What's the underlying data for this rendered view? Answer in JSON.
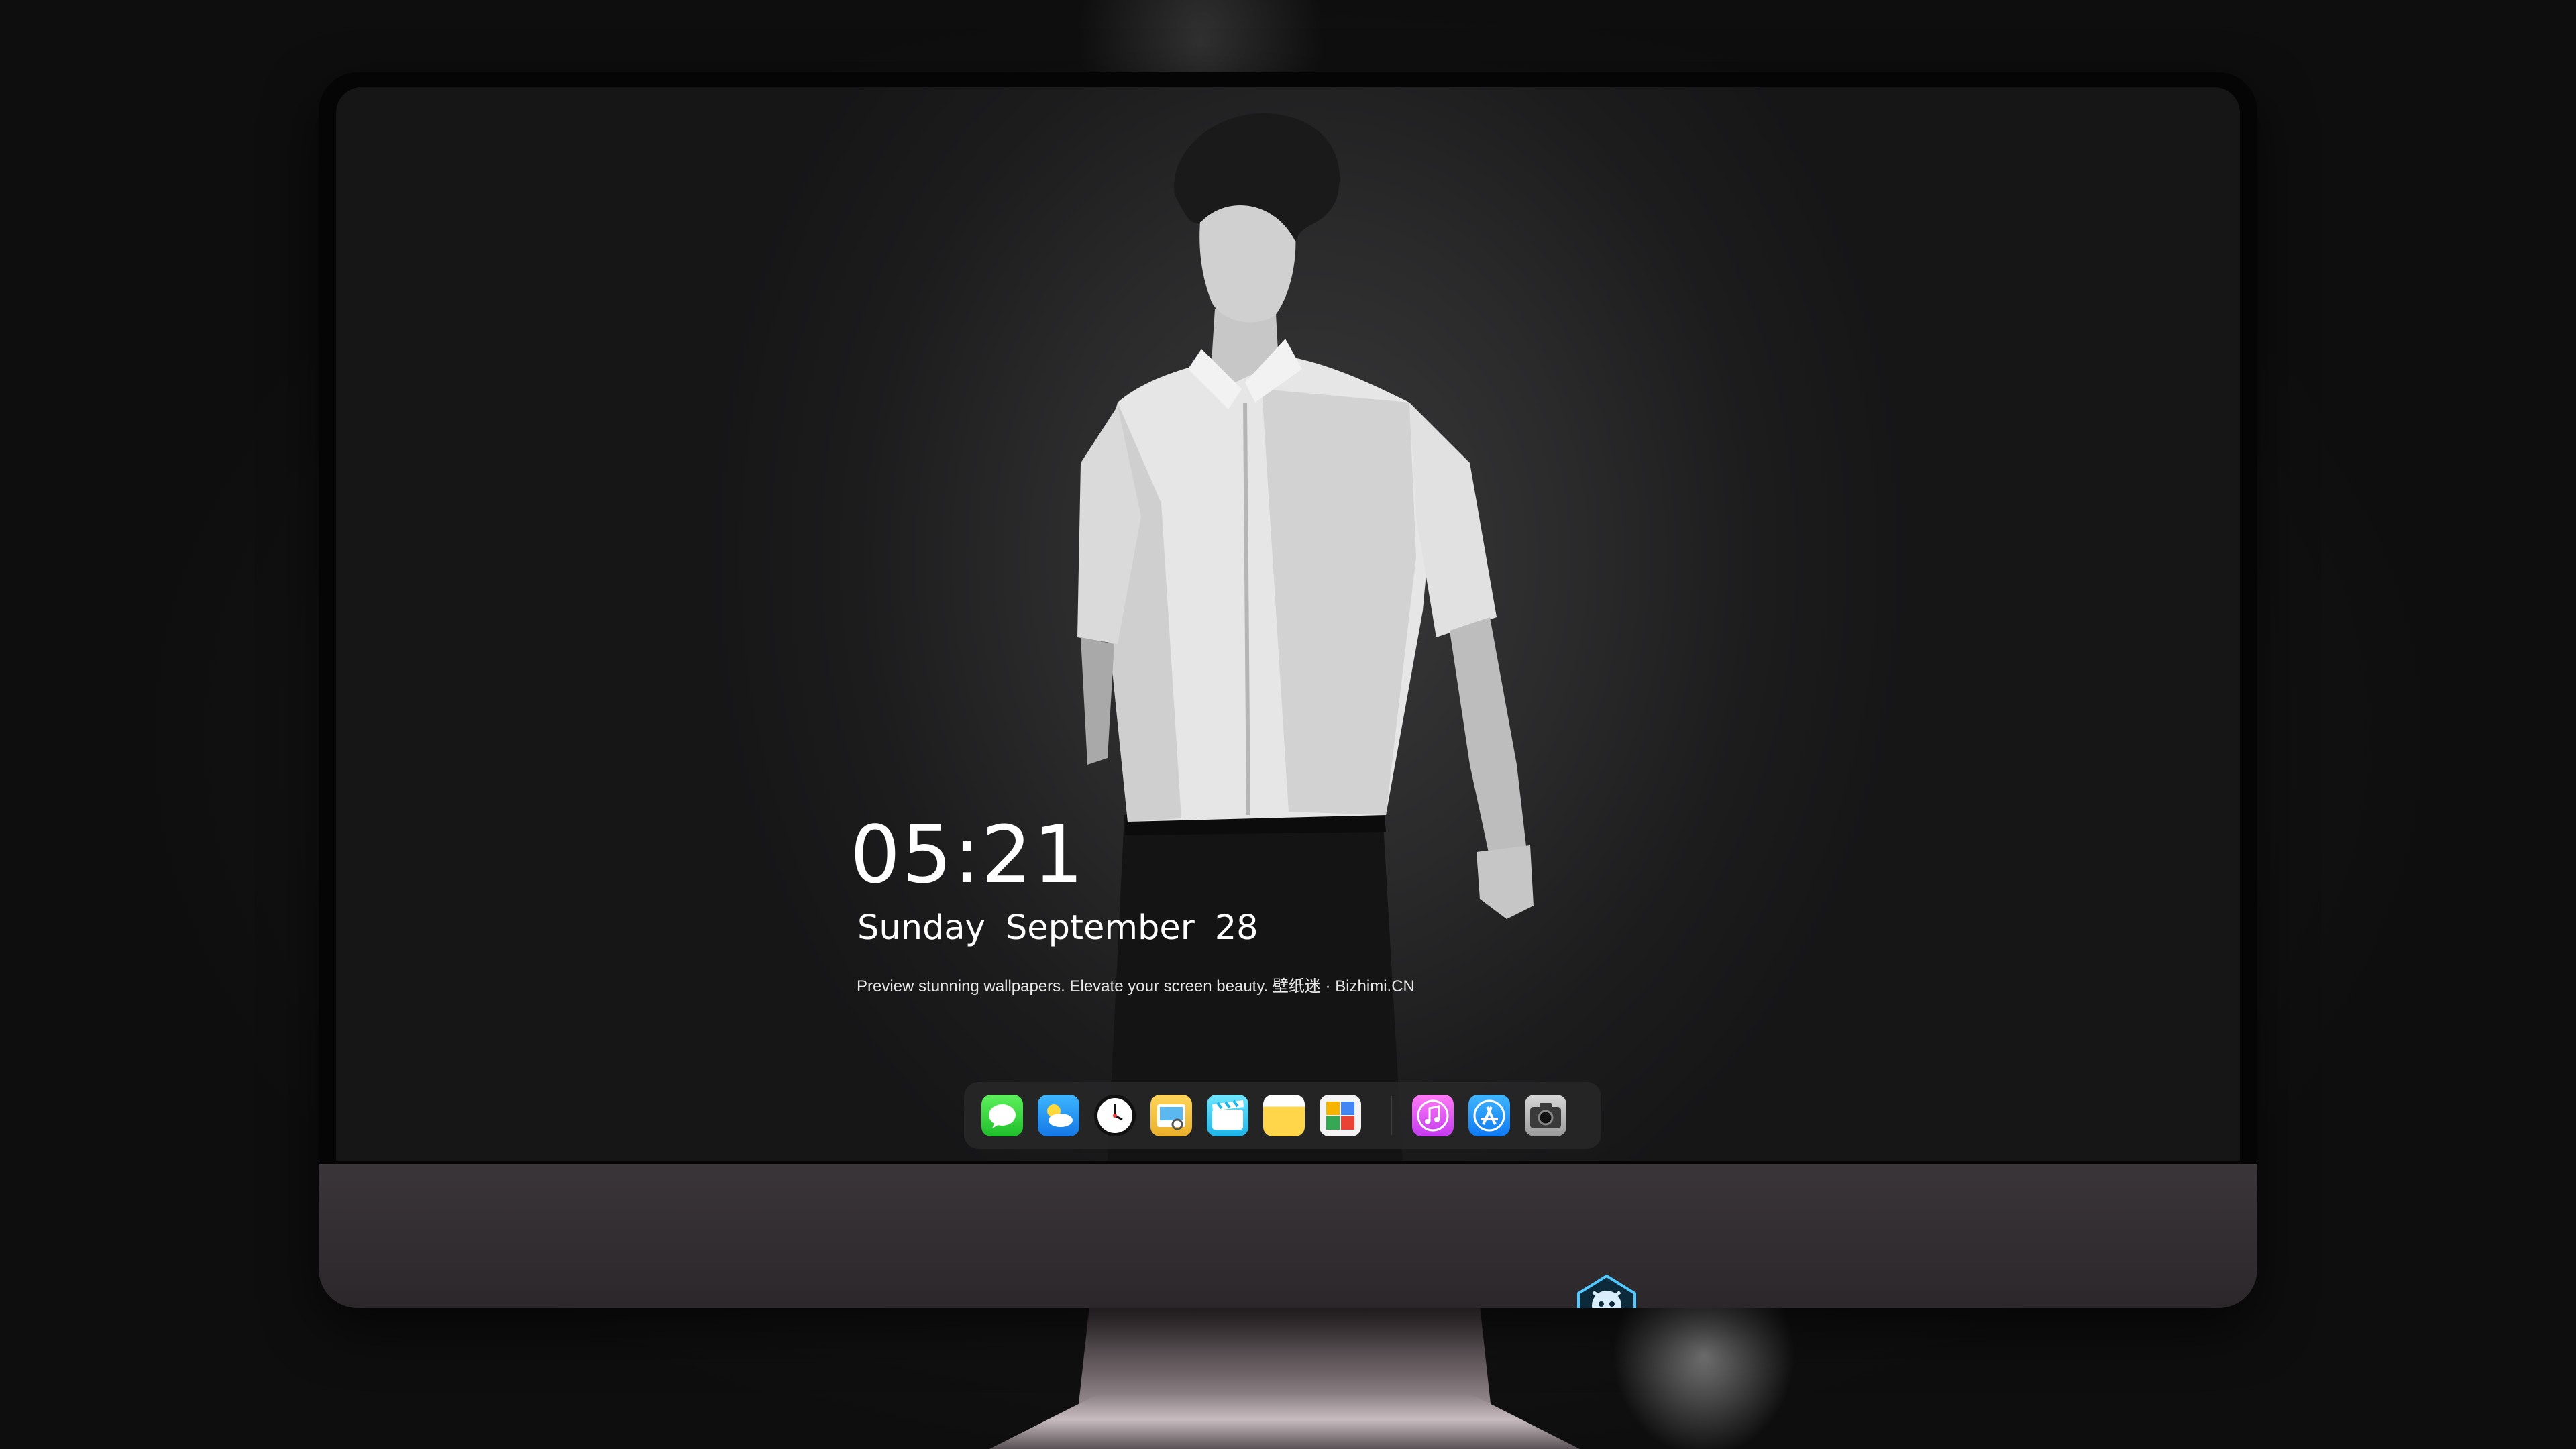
{
  "lockscreen": {
    "time": "05:21",
    "weekday": "Sunday",
    "month": "September",
    "day": "28",
    "caption": "Preview stunning wallpapers. Elevate your screen beauty. 壁纸迷 · Bizhimi.CN"
  },
  "dock": {
    "apps": [
      {
        "name": "messages-icon",
        "color": "#2fd33a"
      },
      {
        "name": "weather-icon",
        "color": "#2e9cff"
      },
      {
        "name": "clock-icon",
        "color": "#111111"
      },
      {
        "name": "preview-icon",
        "color": "#f2c33e"
      },
      {
        "name": "clips-icon",
        "color": "#38c8f0"
      },
      {
        "name": "notes-icon",
        "color": "#ffd64a"
      },
      {
        "name": "photos-icon",
        "color": "#f4f4f4"
      },
      {
        "name": "itunes-icon",
        "color": "#e056f2"
      },
      {
        "name": "app-store-icon",
        "color": "#1a8cf6"
      },
      {
        "name": "camera-icon",
        "color": "#bdbdbd"
      }
    ]
  },
  "colors": {
    "chin": "#352f33",
    "screen_bezel": "#050505",
    "background": "#121212"
  }
}
